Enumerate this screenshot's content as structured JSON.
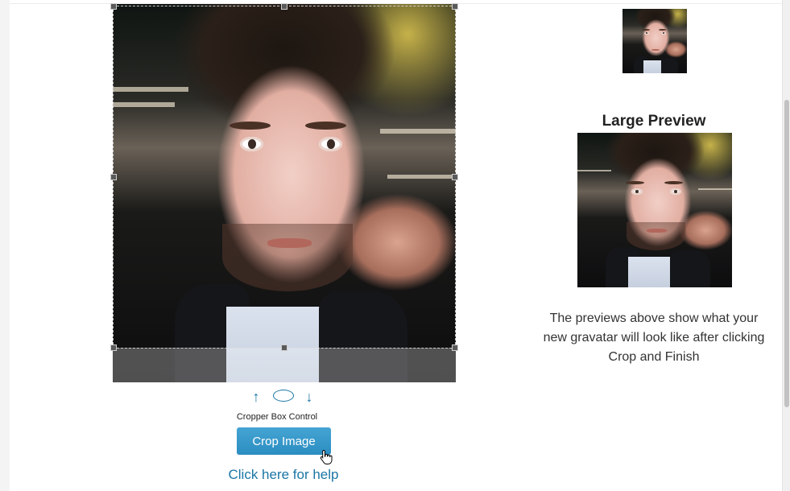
{
  "cropper": {
    "image_alt": "Profile photo being cropped",
    "control_label": "Cropper Box Control",
    "controls": {
      "up_icon": "arrow-up-icon",
      "circle_icon": "circle-icon",
      "down_icon": "arrow-down-icon",
      "up_glyph": "↑",
      "down_glyph": "↓"
    }
  },
  "actions": {
    "crop_label": "Crop Image",
    "help_label": "Click here for help"
  },
  "preview": {
    "large_title": "Large Preview",
    "description": "The previews above show what your new gravatar will look like after clicking Crop and Finish"
  },
  "colors": {
    "accent": "#2b8dc1",
    "link": "#1a75a5"
  }
}
